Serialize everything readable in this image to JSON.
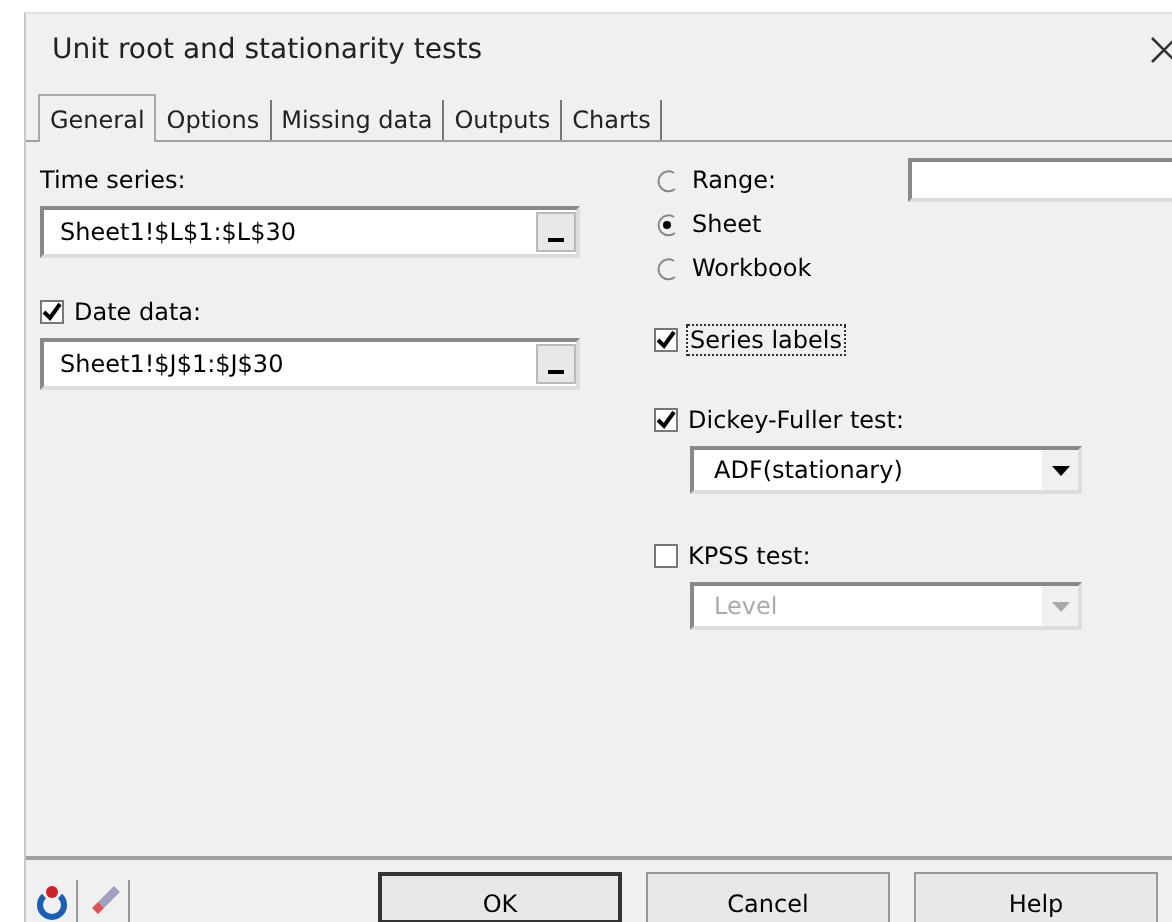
{
  "window": {
    "title": "Unit root and stationarity tests"
  },
  "tabs": [
    {
      "label": "General",
      "selected": true
    },
    {
      "label": "Options",
      "selected": false
    },
    {
      "label": "Missing data",
      "selected": false
    },
    {
      "label": "Outputs",
      "selected": false
    },
    {
      "label": "Charts",
      "selected": false
    }
  ],
  "time_series": {
    "label": "Time series:",
    "value": "Sheet1!$L$1:$L$30"
  },
  "date_data": {
    "label": "Date data:",
    "checked": true,
    "value": "Sheet1!$J$1:$J$30"
  },
  "scope": [
    {
      "label": "Range:",
      "selected": false
    },
    {
      "label": "Sheet",
      "selected": true
    },
    {
      "label": "Workbook",
      "selected": false
    }
  ],
  "series_labels": {
    "label": "Series labels",
    "checked": true
  },
  "tests": [
    {
      "label": "Dickey-Fuller test:",
      "checked": true,
      "option": "ADF(stationary)",
      "disabled": false
    },
    {
      "label": "KPSS test:",
      "checked": false,
      "option": "Level",
      "disabled": true
    }
  ],
  "buttons": [
    "OK",
    "Cancel",
    "Help"
  ]
}
